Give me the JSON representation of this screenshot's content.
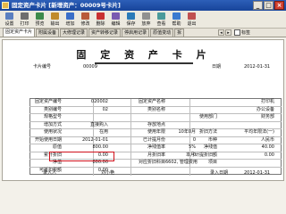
{
  "window": {
    "title": "固定资产卡片 [新增资产：00009号卡片]",
    "controls": [
      "_",
      "□",
      "×"
    ]
  },
  "toolbar": [
    {
      "label": "设置",
      "icon": "settings-icon",
      "color": "#5a7fc0"
    },
    {
      "label": "打印",
      "icon": "print-icon",
      "color": "#6d6d6d"
    },
    {
      "label": "预览",
      "icon": "preview-icon",
      "color": "#3c8a4a"
    },
    {
      "label": "输出",
      "icon": "export-icon",
      "color": "#c08a2a"
    },
    {
      "label": "增加",
      "icon": "add-icon",
      "color": "#3a6ec8"
    },
    {
      "label": "修改",
      "icon": "edit-icon",
      "color": "#b85a3a"
    },
    {
      "label": "删除",
      "icon": "delete-icon",
      "color": "#c83030"
    },
    {
      "label": "编辑",
      "icon": "compose-icon",
      "color": "#7a5ab0"
    },
    {
      "label": "保存",
      "icon": "save-icon",
      "color": "#2a7ab8"
    },
    {
      "label": "放弃",
      "icon": "discard-icon",
      "color": "#909090"
    },
    {
      "label": "查看",
      "icon": "view-icon",
      "color": "#4a9a9a"
    },
    {
      "label": "帮助",
      "icon": "help-icon",
      "color": "#3a7ad0"
    },
    {
      "label": "退出",
      "icon": "exit-icon",
      "color": "#c05050"
    }
  ],
  "tabs": [
    "固定资产卡片",
    "附属设备",
    "大修理记录",
    "资产转移记录",
    "停启用记录",
    "原值变动",
    "拆"
  ],
  "tab_option": "标签",
  "card": {
    "title": "固 定 资 产 卡 片",
    "card_no_label": "卡片编号",
    "card_no": "00009",
    "date_label": "日期",
    "date": "2012-01-31",
    "left": [
      {
        "label": "固定资产编号",
        "value": "020002"
      },
      {
        "label": "类别编号",
        "value": "02"
      },
      {
        "label": "规格型号",
        "value": ""
      },
      {
        "label": "增加方式",
        "value": "直接购入"
      },
      {
        "label": "使用状况",
        "value": "在用"
      },
      {
        "label": "开始使用日期",
        "value": "2012-01-01"
      },
      {
        "label": "原值",
        "value": "800.00"
      },
      {
        "label": "累计折旧",
        "value": "0.00"
      },
      {
        "label": "净值",
        "value": "800.00"
      },
      {
        "label": "可抵扣税额",
        "value": "0.00"
      }
    ],
    "middle": [
      {
        "label": "固定资产名称",
        "value": ""
      },
      {
        "label": "类别名称",
        "value": ""
      },
      {
        "label": "",
        "value": ""
      },
      {
        "label": "存放地点",
        "value": ""
      },
      {
        "label": "使用年限",
        "value": "10年0月"
      },
      {
        "label": "已计提月份",
        "value": "0"
      },
      {
        "label": "净残值率",
        "value": "5%"
      },
      {
        "label": "月折旧率",
        "value": "0"
      },
      {
        "label": "对应折旧科目",
        "value": "6602, 管理费用"
      },
      {
        "label": "",
        "value": ""
      }
    ],
    "right": [
      {
        "label": "",
        "value": "打印机"
      },
      {
        "label": "",
        "value": "办公设备"
      },
      {
        "label": "使用部门",
        "value": "财务部"
      },
      {
        "label": "",
        "value": ""
      },
      {
        "label": "折旧方法",
        "value": "平均年限法(一)"
      },
      {
        "label": "币种",
        "value": "人民币"
      },
      {
        "label": "净残值",
        "value": "40.00"
      },
      {
        "label": "本月计提折旧额",
        "value": "0.00"
      },
      {
        "label": "项目",
        "value": ""
      },
      {
        "label": "",
        "value": ""
      }
    ],
    "footer": {
      "entry_label": "录入人",
      "entry_value": "刘小艳",
      "date_label": "录入日期",
      "date_value": "2012-01-31"
    }
  }
}
